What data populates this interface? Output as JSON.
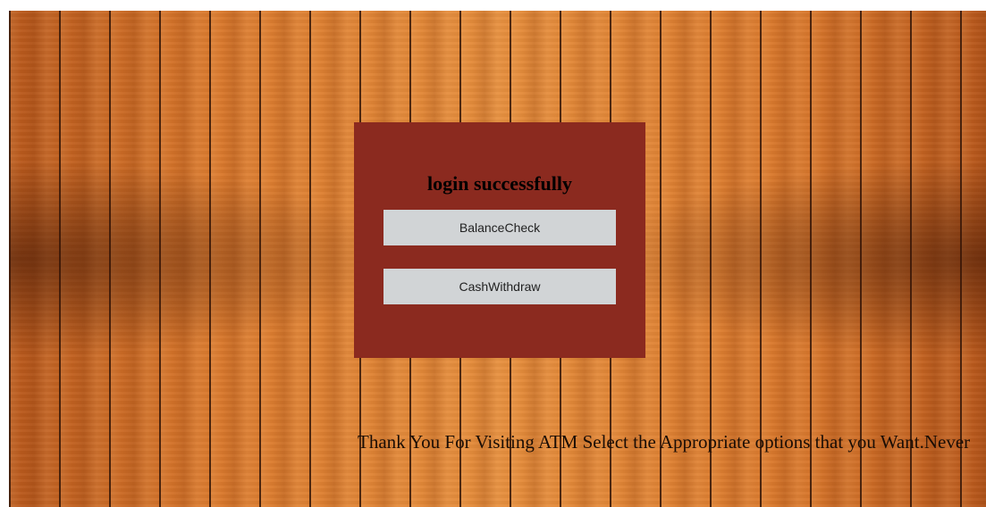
{
  "panel": {
    "title": "login successfully",
    "buttons": {
      "balance_label": "BalanceCheck",
      "withdraw_label": "CashWithdraw"
    }
  },
  "marquee": {
    "text": "Thank You For Visiting ATM Select the Appropriate options that you Want.Never"
  },
  "colors": {
    "panel_bg": "#8b2a1f",
    "button_bg": "#d1d4d6",
    "wood_main": "#e58d3c"
  }
}
